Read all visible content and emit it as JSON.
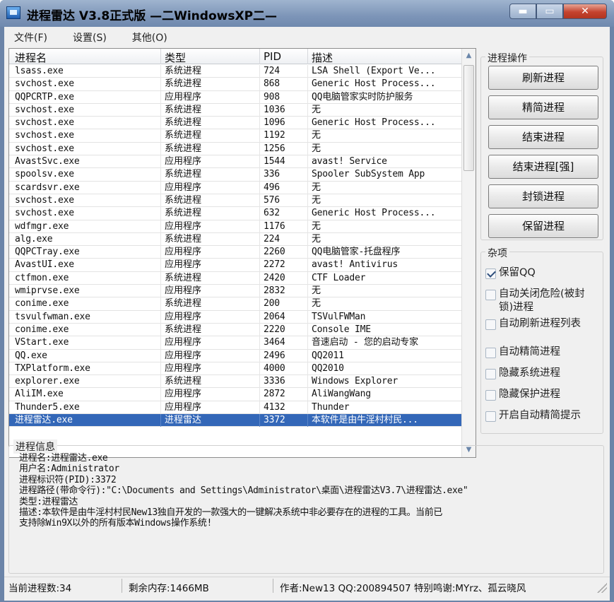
{
  "window": {
    "title": "进程雷达 V3.8正式版 —二WindowsXP二—",
    "buttons": {
      "minimize": "▬",
      "maximize": "▭",
      "close": "✕"
    }
  },
  "menu": [
    "文件(F)",
    "设置(S)",
    "其他(O)"
  ],
  "process_list": {
    "columns": [
      "进程名",
      "类型",
      "PID",
      "描述"
    ],
    "rows": [
      [
        "lsass.exe",
        "系统进程",
        "724",
        "LSA Shell (Export Ve..."
      ],
      [
        "svchost.exe",
        "系统进程",
        "868",
        "Generic Host Process..."
      ],
      [
        "QQPCRTP.exe",
        "应用程序",
        "908",
        "QQ电脑管家实时防护服务"
      ],
      [
        "svchost.exe",
        "系统进程",
        "1036",
        "无"
      ],
      [
        "svchost.exe",
        "系统进程",
        "1096",
        "Generic Host Process..."
      ],
      [
        "svchost.exe",
        "系统进程",
        "1192",
        "无"
      ],
      [
        "svchost.exe",
        "系统进程",
        "1256",
        "无"
      ],
      [
        "AvastSvc.exe",
        "应用程序",
        "1544",
        "avast! Service"
      ],
      [
        "spoolsv.exe",
        "系统进程",
        "336",
        "Spooler SubSystem App"
      ],
      [
        "scardsvr.exe",
        "应用程序",
        "496",
        "无"
      ],
      [
        "svchost.exe",
        "系统进程",
        "576",
        "无"
      ],
      [
        "svchost.exe",
        "系统进程",
        "632",
        "Generic Host Process..."
      ],
      [
        "wdfmgr.exe",
        "应用程序",
        "1176",
        "无"
      ],
      [
        "alg.exe",
        "系统进程",
        "224",
        "无"
      ],
      [
        "QQPCTray.exe",
        "应用程序",
        "2260",
        "QQ电脑管家-托盘程序"
      ],
      [
        "AvastUI.exe",
        "应用程序",
        "2272",
        "avast! Antivirus"
      ],
      [
        "ctfmon.exe",
        "系统进程",
        "2420",
        "CTF Loader"
      ],
      [
        "wmiprvse.exe",
        "应用程序",
        "2832",
        "无"
      ],
      [
        "conime.exe",
        "系统进程",
        "200",
        "无"
      ],
      [
        "tsvulfwman.exe",
        "应用程序",
        "2064",
        "TSVulFWMan"
      ],
      [
        "conime.exe",
        "系统进程",
        "2220",
        "Console IME"
      ],
      [
        "VStart.exe",
        "应用程序",
        "3464",
        "音速启动 - 您的启动专家"
      ],
      [
        "QQ.exe",
        "应用程序",
        "2496",
        "QQ2011"
      ],
      [
        "TXPlatform.exe",
        "应用程序",
        "4000",
        "QQ2010"
      ],
      [
        "explorer.exe",
        "系统进程",
        "3336",
        "Windows Explorer"
      ],
      [
        "AliIM.exe",
        "应用程序",
        "2872",
        "AliWangWang"
      ],
      [
        "Thunder5.exe",
        "应用程序",
        "4132",
        "Thunder"
      ],
      [
        "进程雷达.exe",
        "进程雷达",
        "3372",
        "本软件是由牛淫村村民..."
      ]
    ]
  },
  "actions": {
    "title": "进程操作",
    "buttons": [
      "刷新进程",
      "精简进程",
      "结束进程",
      "结束进程[强]",
      "封锁进程",
      "保留进程"
    ]
  },
  "misc": {
    "title": "杂项",
    "options": [
      {
        "label": "保留QQ",
        "checked": true
      },
      {
        "label": "自动关闭危险(被封锁)进程",
        "checked": false
      },
      {
        "label": "自动刷新进程列表",
        "checked": false
      },
      {
        "label": "自动精简进程",
        "checked": false
      },
      {
        "label": "隐藏系统进程",
        "checked": false
      },
      {
        "label": "隐藏保护进程",
        "checked": false
      },
      {
        "label": "开启自动精简提示",
        "checked": false
      }
    ]
  },
  "info": {
    "title": "进程信息",
    "lines": [
      "进程名:进程雷达.exe",
      "用户名:Administrator",
      "进程标识符(PID):3372",
      "进程路径(带命令行):\"C:\\Documents and Settings\\Administrator\\桌面\\进程雷达V3.7\\进程雷达.exe\"",
      "类型:进程雷达",
      "描述:本软件是由牛淫村村民New13独自开发的一款强大的一键解决系统中非必要存在的进程的工具。当前已",
      "支持除Win9X以外的所有版本Windows操作系统!"
    ]
  },
  "status": {
    "process_count": "当前进程数:34",
    "memory": "剩余内存:1466MB",
    "credits": "作者:New13 QQ:200894507 特别鸣谢:MYrz、孤云晓风"
  }
}
